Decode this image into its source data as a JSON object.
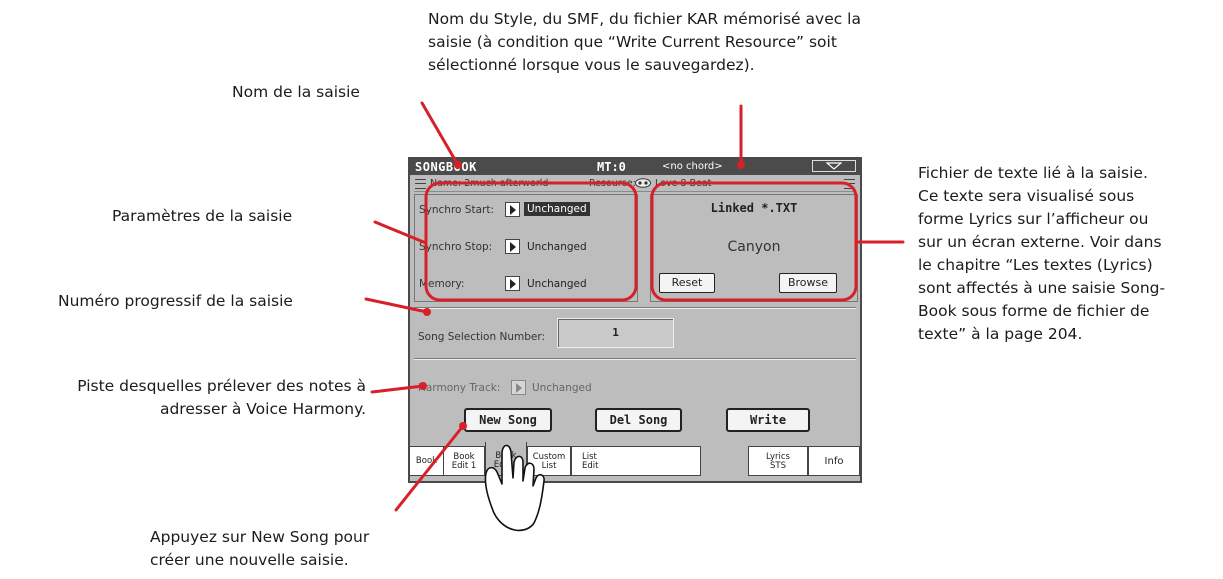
{
  "annotations": {
    "resource_note": [
      "Nom du Style, du SMF, du fichier KAR mémorisé avec la",
      "saisie (à condition que “Write Current Resource” soit",
      "sélectionné lorsque vous le sauvegardez)."
    ],
    "entry_name": "Nom de la saisie",
    "entry_params": "Paramètres de la saisie",
    "progressive_number": "Numéro progressif de la saisie",
    "harmony_track": [
      "Piste desquelles prélever des notes à",
      "adresser à Voice Harmony."
    ],
    "new_song_hint": [
      "Appuyez sur New Song pour",
      "créer une nouvelle saisie."
    ],
    "linked_text": [
      "Fichier de texte lié à la saisie.",
      "Ce texte sera visualisé sous",
      "forme Lyrics sur l’afficheur ou",
      "sur un écran externe. Voir dans",
      "le chapitre “Les textes (Lyrics)",
      "sont affectés à une saisie Song-",
      "Book sous forme de fichier de",
      "texte” à la page 204."
    ]
  },
  "screen": {
    "title": "SONGBOOK",
    "mt": "MT:0",
    "chord": "<no chord>",
    "name_label": "Name: 2much afterworld",
    "resource_label": "Resource:",
    "resource_value": "Love 8 Beat",
    "synchro_start_label": "Synchro Start:",
    "synchro_start_value": "Unchanged",
    "synchro_stop_label": "Synchro Stop:",
    "synchro_stop_value": "Unchanged",
    "memory_label": "Memory:",
    "memory_value": "Unchanged",
    "linked_title": "Linked *.TXT",
    "linked_file": "Canyon",
    "reset_label": "Reset",
    "browse_label": "Browse",
    "song_selection_label": "Song Selection Number:",
    "song_selection_value": "1",
    "harmony_track_label": "Harmony Track:",
    "harmony_track_value": "Unchanged",
    "new_song_label": "New Song",
    "del_song_label": "Del Song",
    "write_label": "Write",
    "tabs": [
      {
        "line1": "Book",
        "line2": ""
      },
      {
        "line1": "Book",
        "line2": "Edit 1"
      },
      {
        "line1": "Book",
        "line2": "Edit 2"
      },
      {
        "line1": "Custom",
        "line2": "List"
      },
      {
        "line1": "List",
        "line2": "Edit"
      },
      {
        "line1": "Lyrics",
        "line2": "STS"
      },
      {
        "line1": "Info",
        "line2": ""
      }
    ],
    "active_tab": "Book Edit 2"
  },
  "colors": {
    "callout": "#d8202a",
    "screen_bg": "#bdbdbd",
    "header_bg": "#4b4b4b"
  }
}
